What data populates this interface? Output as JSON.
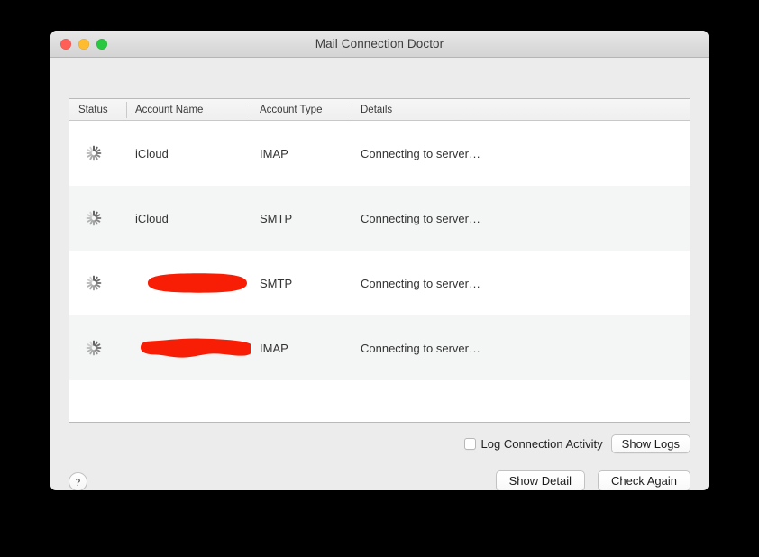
{
  "window": {
    "title": "Mail Connection Doctor",
    "traffic_lights": [
      {
        "name": "close",
        "label": "Close",
        "color": "#ff5f57"
      },
      {
        "name": "minimize",
        "label": "Minimize",
        "color": "#febc2e"
      },
      {
        "name": "zoom",
        "label": "Zoom",
        "color": "#28c840"
      }
    ]
  },
  "table": {
    "columns": [
      {
        "key": "status",
        "label": "Status"
      },
      {
        "key": "name",
        "label": "Account Name"
      },
      {
        "key": "type",
        "label": "Account Type"
      },
      {
        "key": "details",
        "label": "Details"
      }
    ],
    "rows": [
      {
        "status_icon": "spinner-icon",
        "name": "iCloud",
        "name_redacted": false,
        "type": "IMAP",
        "details": "Connecting to server…"
      },
      {
        "status_icon": "spinner-icon",
        "name": "iCloud",
        "name_redacted": false,
        "type": "SMTP",
        "details": "Connecting to server…"
      },
      {
        "status_icon": "spinner-icon",
        "name": "",
        "name_redacted": true,
        "type": "SMTP",
        "details": "Connecting to server…"
      },
      {
        "status_icon": "spinner-icon",
        "name": "",
        "name_redacted": true,
        "type": "IMAP",
        "details": "Connecting to server…"
      }
    ],
    "redaction_color": "#f81e06"
  },
  "controls": {
    "log_checkbox": {
      "label": "Log Connection Activity",
      "checked": false
    },
    "show_logs_label": "Show Logs",
    "show_detail_label": "Show Detail",
    "check_again_label": "Check Again",
    "help_label": "?"
  }
}
